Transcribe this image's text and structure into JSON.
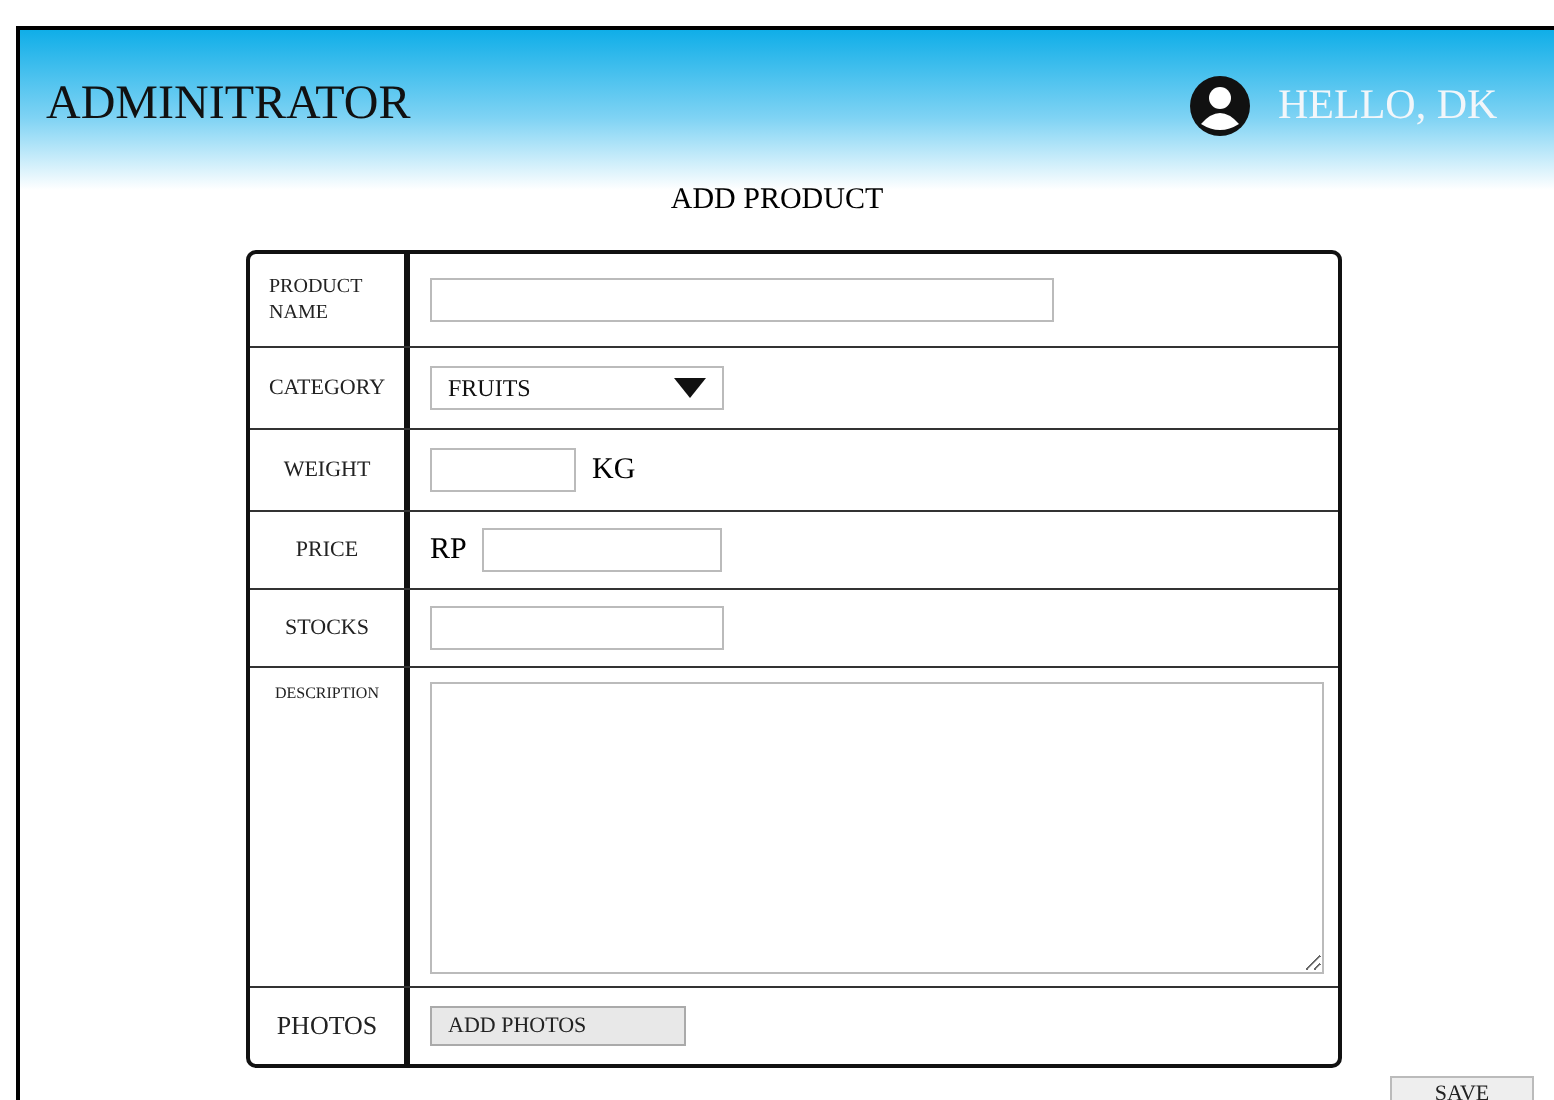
{
  "header": {
    "title": "ADMINITRATOR",
    "greeting": "HELLO, DK"
  },
  "page_title": "ADD PRODUCT",
  "form": {
    "rows": [
      {
        "kind": "text",
        "label": "PRODUCT NAME"
      },
      {
        "kind": "select",
        "label": "CATEGORY",
        "value": "FRUITS"
      },
      {
        "kind": "suffix",
        "label": "WEIGHT",
        "unit": "KG"
      },
      {
        "kind": "prefix",
        "label": "PRICE",
        "unit": "RP"
      },
      {
        "kind": "short",
        "label": "STOCKS"
      },
      {
        "kind": "textarea",
        "label": "DESCRIPTION"
      },
      {
        "kind": "upload",
        "label": "PHOTOS",
        "button": "ADD PHOTOS"
      }
    ]
  },
  "save_button": "SAVE"
}
